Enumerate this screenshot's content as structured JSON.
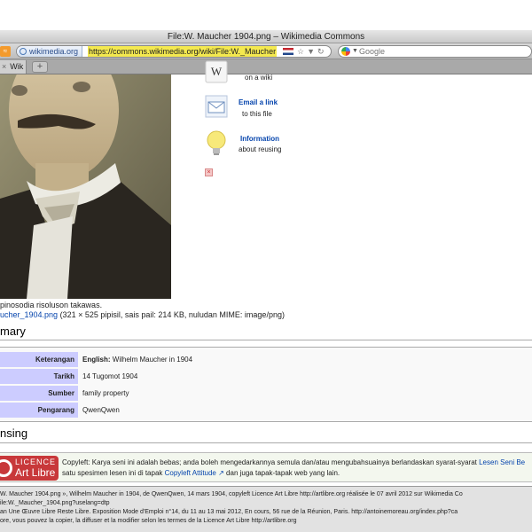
{
  "window": {
    "title": "File:W. Maucher 1904.png – Wikimedia Commons"
  },
  "navbar": {
    "site_identity": "wikimedia.org",
    "url": "https://commons.wikimedia.org/wiki/File:W._Maucher",
    "search_placeholder": "Google"
  },
  "tabs": [
    {
      "label": "Wik"
    }
  ],
  "sidebar": {
    "items": [
      {
        "title": "",
        "subtitle": "on a wiki",
        "icon": "wiki-icon"
      },
      {
        "title": "Email a link",
        "subtitle": "to this file",
        "icon": "email-icon"
      },
      {
        "title": "Information",
        "subtitle": "about reusing",
        "icon": "lightbulb-icon"
      }
    ]
  },
  "image": {
    "caption": "pinosodia risoluson takawas.",
    "file_link": "ucher_1904.png",
    "file_details": " (321 × 525 pipisil, sais pail: 214 KB, nuludan MIME: image/png)"
  },
  "summary": {
    "heading": "mary",
    "rows": [
      {
        "key": "Keterangan",
        "value_bold": "English:",
        "value": " Wilhelm Maucher in 1904"
      },
      {
        "key": "Tarikh",
        "value_bold": "",
        "value": "14 Tugomot 1904"
      },
      {
        "key": "Sumber",
        "value_bold": "",
        "value": "family property"
      },
      {
        "key": "Pengarang",
        "value_bold": "",
        "value": "QwenQwen",
        "is_link": true
      }
    ]
  },
  "licensing": {
    "heading": "nsing",
    "logo_line1": "LICENCE",
    "logo_line2": "Art Libre",
    "line1_text": "Copyleft: Karya seni ini adalah bebas; anda boleh mengedarkannya semula dan/atau mengubahsuainya berlandaskan syarat-syarat ",
    "line1_link": "Lesen Seni Be",
    "line2_text_a": "satu spesimen lesen ini di tapak ",
    "line2_link": "Copyleft Attitude",
    "line2_text_b": " dan juga tapak-tapak web yang lain."
  },
  "statusbar": {
    "lines": [
      "W. Maucher 1904.png », Wilhelm Maucher in 1904, de QwenQwen, 14 mars 1904, copyleft Licence Art Libre http://artlibre.org réalisée le 07 avril 2012 sur Wikimedia Co",
      "ile:W._Maucher_1904.png?uselang=dtp",
      "an Une Œuvre Libre Reste Libre. Exposition Mode d'Emploi n°14, du 11 au 13 mai 2012, En cours, 56 rue de la Réunion, Paris. http://antoinemoreau.org/index.php?ca",
      "ore, vous pouvez la copier, la diffuser et la modifier selon les termes de la Licence Art Libre http://artlibre.org"
    ]
  },
  "colors": {
    "link": "#0645ad",
    "table_key_bg": "#ccccff",
    "url_highlight": "#f4e94f",
    "license_logo": "#c8383a"
  }
}
